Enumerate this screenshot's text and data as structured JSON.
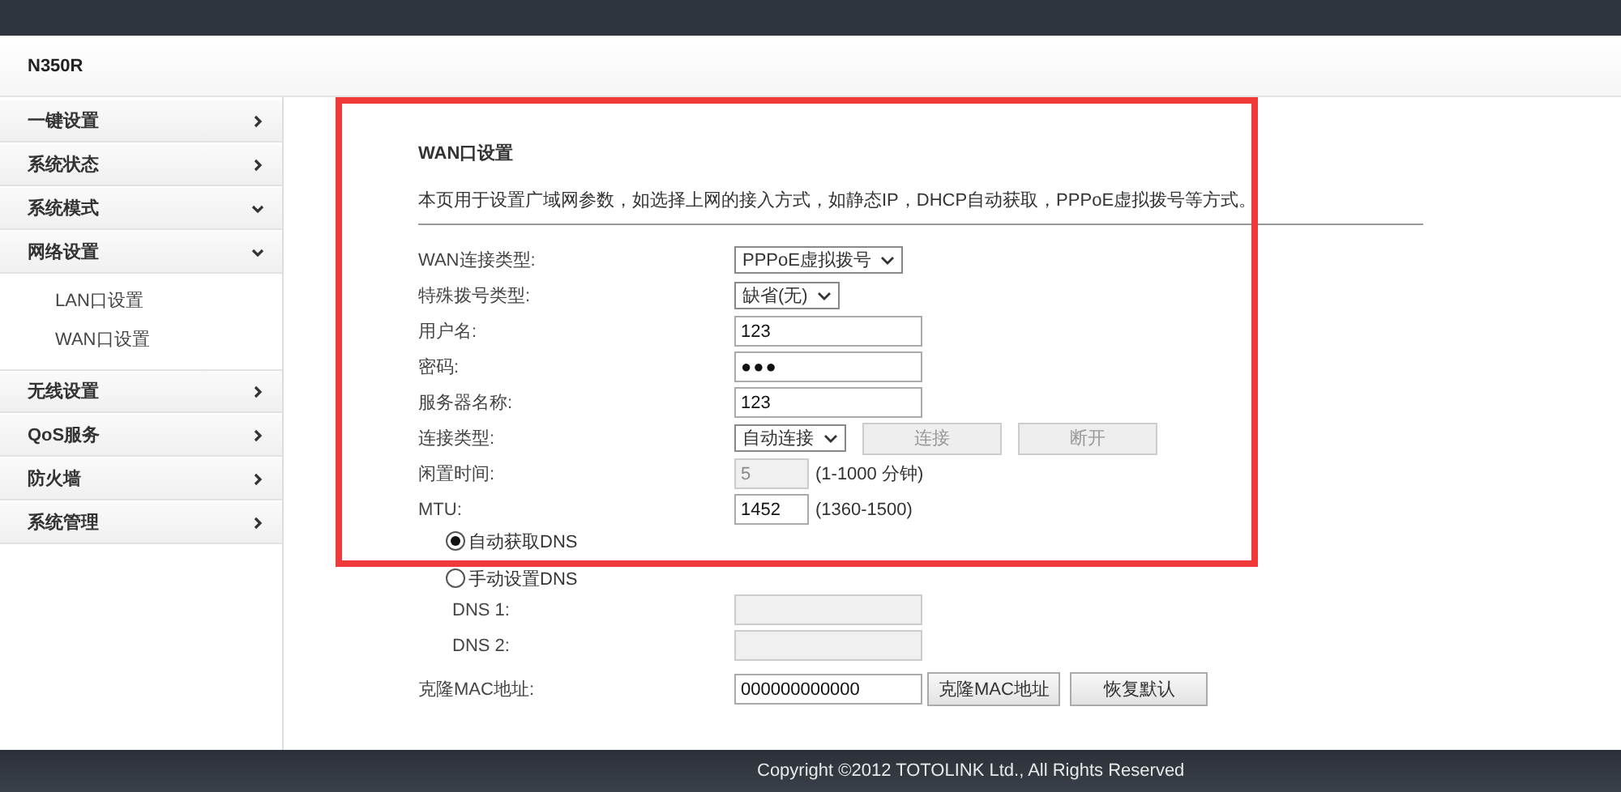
{
  "header": {
    "title": "N350R"
  },
  "sidebar": {
    "items": [
      {
        "label": "一键设置",
        "expanded": false
      },
      {
        "label": "系统状态",
        "expanded": false
      },
      {
        "label": "系统模式",
        "expanded": true
      },
      {
        "label": "网络设置",
        "expanded": true,
        "children": [
          {
            "label": "LAN口设置"
          },
          {
            "label": "WAN口设置"
          }
        ]
      },
      {
        "label": "无线设置",
        "expanded": false
      },
      {
        "label": "QoS服务",
        "expanded": false
      },
      {
        "label": "防火墙",
        "expanded": false
      },
      {
        "label": "系统管理",
        "expanded": false
      }
    ]
  },
  "page": {
    "title": "WAN口设置",
    "description": "本页用于设置广域网参数，如选择上网的接入方式，如静态IP，DHCP自动获取，PPPoE虚拟拨号等方式。",
    "rows": [
      {
        "label": "WAN连接类型:",
        "kind": "select",
        "value": "PPPoE虚拟拨号"
      },
      {
        "label": "特殊拨号类型:",
        "kind": "select",
        "value": "缺省(无)"
      },
      {
        "label": "用户名:",
        "kind": "text",
        "value": "123"
      },
      {
        "label": "密码:",
        "kind": "password",
        "value": "●●●"
      },
      {
        "label": "服务器名称:",
        "kind": "text",
        "value": "123"
      },
      {
        "label": "连接类型:",
        "kind": "select",
        "value": "自动连接",
        "buttons": [
          {
            "label": "连接",
            "disabled": true
          },
          {
            "label": "断开",
            "disabled": true
          }
        ]
      },
      {
        "label": "闲置时间:",
        "kind": "short",
        "value": "5",
        "disabled": true,
        "hint": "(1-1000 分钟)"
      },
      {
        "label": "MTU:",
        "kind": "short",
        "value": "1452",
        "disabled": false,
        "hint": "(1360-1500)"
      }
    ],
    "dns_modes": [
      {
        "label": "自动获取DNS",
        "selected": true
      },
      {
        "label": "手动设置DNS",
        "selected": false
      }
    ],
    "dns_fields": [
      {
        "label": "DNS 1:",
        "disabled": true
      },
      {
        "label": "DNS 2:",
        "disabled": true
      }
    ],
    "mac": {
      "label": "克隆MAC地址:",
      "value": "000000000000",
      "buttons": [
        {
          "label": "克隆MAC地址",
          "disabled": false
        },
        {
          "label": "恢复默认",
          "disabled": false
        }
      ]
    }
  },
  "footer": {
    "text": "Copyright ©2012 TOTOLINK Ltd., All Rights Reserved"
  }
}
